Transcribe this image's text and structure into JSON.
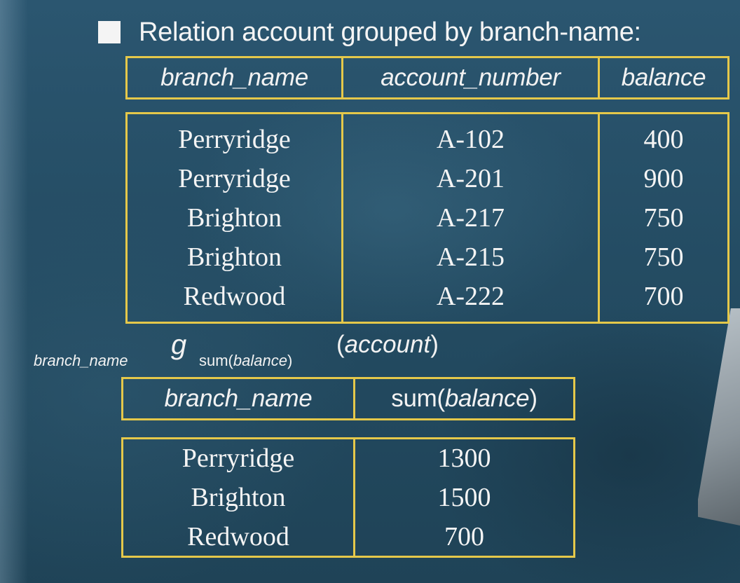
{
  "heading": "Relation account grouped by branch-name:",
  "table1": {
    "headers": [
      "branch_name",
      "account_number",
      "balance"
    ],
    "rows": [
      [
        "Perryridge",
        "A-102",
        "400"
      ],
      [
        "Perryridge",
        "A-201",
        "900"
      ],
      [
        "Brighton",
        "A-217",
        "750"
      ],
      [
        "Brighton",
        "A-215",
        "750"
      ],
      [
        "Redwood",
        "A-222",
        "700"
      ]
    ]
  },
  "expression": {
    "group_attr": "branch_name",
    "g": "g",
    "agg_func": "sum(",
    "agg_attr": "balance",
    "agg_close": ")",
    "open": "(",
    "relation": "account",
    "close": ")"
  },
  "table2": {
    "header_1": "branch_name",
    "header_2_func": "sum(",
    "header_2_attr": "balance",
    "header_2_close": ")",
    "rows": [
      [
        "Perryridge",
        "1300"
      ],
      [
        "Brighton",
        "1500"
      ],
      [
        "Redwood",
        "700"
      ]
    ]
  },
  "colors": {
    "border": "#e5c84a",
    "background": "#24495f",
    "text": "#f4f4f4"
  }
}
